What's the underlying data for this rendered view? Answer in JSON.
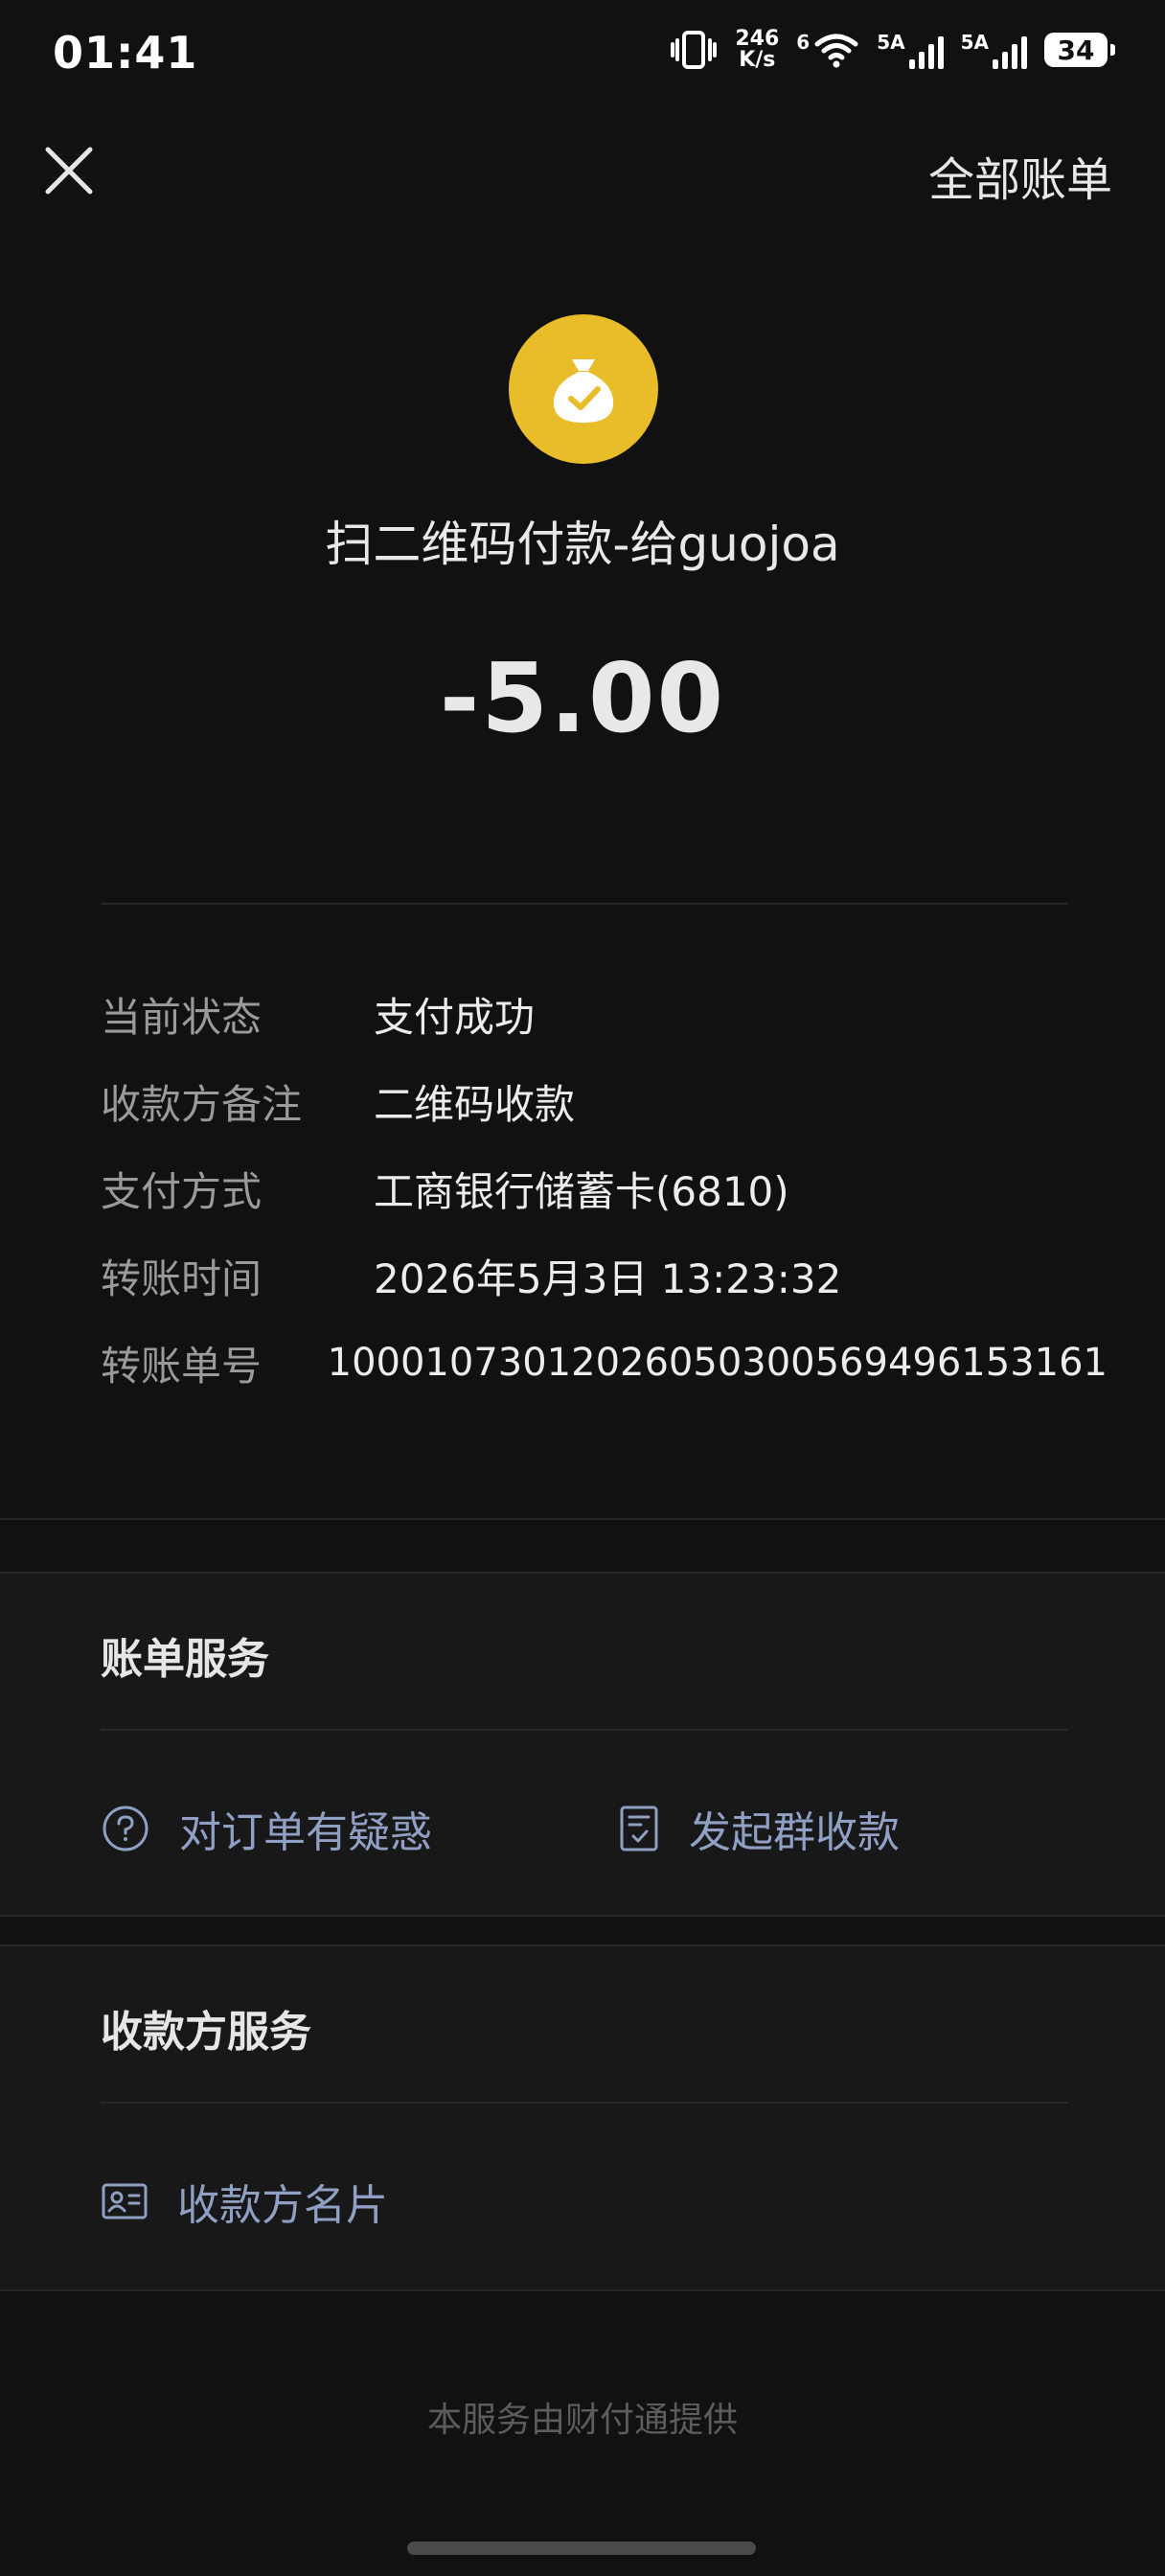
{
  "status_bar": {
    "time": "01:41",
    "net_speed_value": "246",
    "net_speed_unit": "K/s",
    "wifi_label": "6",
    "sim1_label": "5A",
    "sim2_label": "5A",
    "battery": "34"
  },
  "header": {
    "all_bills_label": "全部账单"
  },
  "transaction": {
    "title": "扫二维码付款-给guojoa",
    "amount": "-5.00"
  },
  "details": [
    {
      "label": "当前状态",
      "value": "支付成功"
    },
    {
      "label": "收款方备注",
      "value": "二维码收款"
    },
    {
      "label": "支付方式",
      "value": "工商银行储蓄卡(6810)"
    },
    {
      "label": "转账时间",
      "value": "2026年5月3日 13:23:32"
    },
    {
      "label": "转账单号",
      "value": "1000107301202605030056949615316​1"
    }
  ],
  "bill_service": {
    "title": "账单服务",
    "question_label": "对订单有疑惑",
    "group_collect_label": "发起群收款"
  },
  "payee_service": {
    "title": "收款方服务",
    "payee_card_label": "收款方名片"
  },
  "footer": {
    "note": "本服务由财付通提供"
  },
  "colors": {
    "background": "#111111",
    "section_bg": "#181818",
    "logo_yellow": "#e9bd2a",
    "link_blue": "#8fa0c4"
  }
}
